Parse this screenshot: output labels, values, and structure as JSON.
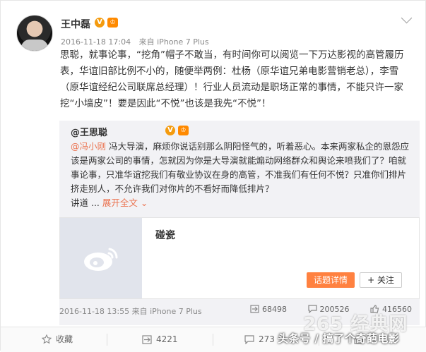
{
  "post": {
    "author": "王中磊",
    "verify_mark": "V",
    "level_mark": "♔",
    "time": "2016-11-18 17:04",
    "source_prefix": "来自",
    "source": "iPhone 7 Plus",
    "text": "思聪，就事论事，“挖角”帽子不敢当，有时间你可以阅览一下万达影视的高管履历表，华谊旧部比例不小的，随便举两例：杜杨（原华谊兄弟电影营销老总），李雪（原华谊经纪公司联席总经理）！行业人员流动是职场正常的事情，不能只许一家挖“小墙皮”！要是因此“不悦”也该是我先“不悦”！"
  },
  "repost": {
    "author": "@王思聪",
    "verify_mark": "V",
    "level_mark": "♔",
    "mention": "@冯小刚",
    "text": " 冯大导演，麻烦你说话别那么阴阳怪气的，听着恶心。本来两家私企的恩怨应该是两家公司的事情，怎就因为你是大导演就能煽动网络群众和舆论来喷我们了？咱就事论事，只准华谊挖我们有敬业协议在身的高管，不准我们有任何不悦？只准你们排片挤走别人，不允许我们对你片的不看好而降低排片？",
    "text_tail": "讲道 ...",
    "expand_label": "展开全文",
    "expand_icon": "chevron-down",
    "link_card": {
      "title": "碰瓷",
      "topic_button": "话题详情",
      "follow_button": "+ 关注"
    },
    "time": "2016-11-18 13:55",
    "source_prefix": "来自",
    "source": "iPhone 7 Plus",
    "stats": {
      "reposts": "68498",
      "comments": "200526",
      "likes": "416560"
    }
  },
  "actions": {
    "favorite": "收藏",
    "repost": "4221",
    "comment": "273",
    "like": ""
  },
  "watermark": {
    "small": "头条号 / 搞了个奇葩电影",
    "large": "265 经典网"
  },
  "colors": {
    "accent": "#eb7350",
    "button": "#ff8140",
    "badge": "#f49b0e"
  }
}
